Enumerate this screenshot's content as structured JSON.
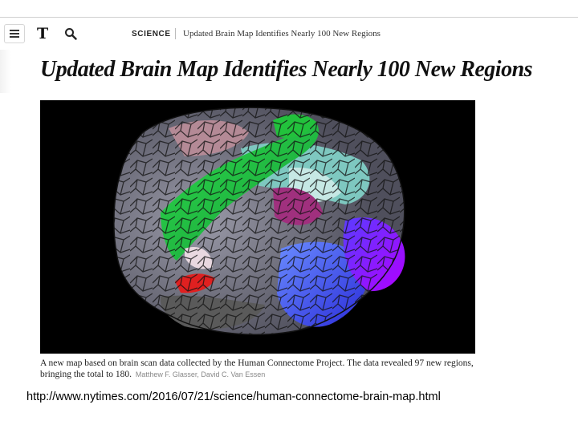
{
  "header": {
    "menu_icon": "hamburger-menu-icon",
    "logo": "T",
    "search_icon": "search-icon",
    "section": "SCIENCE",
    "breadcrumb_title": "Updated Brain Map Identifies Nearly 100 New Regions"
  },
  "article": {
    "headline": "Updated Brain Map Identifies Nearly 100 New Regions",
    "image_icon": "brain-map-image",
    "caption": "A new map based on brain scan data collected by the Human Connectome Project. The data revealed 97 new regions, bringing the total to 180.",
    "credit": "Matthew F. Glasser, David C. Van Essen"
  },
  "footer": {
    "url": "http://www.nytimes.com/2016/07/21/science/human-connectome-brain-map.html"
  },
  "colors": {
    "background": "#ffffff",
    "photo_background": "#000000",
    "headline": "#111111",
    "credit": "#888888"
  }
}
